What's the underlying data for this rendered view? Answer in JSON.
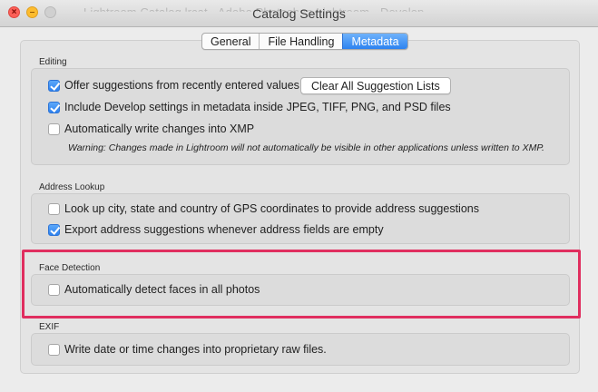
{
  "window": {
    "background_title": "Lightroom Catalog.lrcat - Adobe Photoshop Lightroom - Develop",
    "title": "Catalog Settings"
  },
  "tabs": [
    {
      "label": "General",
      "active": false
    },
    {
      "label": "File Handling",
      "active": false
    },
    {
      "label": "Metadata",
      "active": true
    }
  ],
  "editing": {
    "heading": "Editing",
    "offer_suggestions": {
      "label": "Offer suggestions from recently entered values",
      "checked": true
    },
    "clear_button_label": "Clear All Suggestion Lists",
    "include_develop": {
      "label": "Include Develop settings in metadata inside JPEG, TIFF, PNG, and PSD files",
      "checked": true
    },
    "auto_write_xmp": {
      "label": "Automatically write changes into XMP",
      "checked": false
    },
    "warning": "Warning: Changes made in Lightroom will not automatically be visible in other applications unless written to XMP."
  },
  "address_lookup": {
    "heading": "Address Lookup",
    "lookup_gps": {
      "label": "Look up city, state and country of GPS coordinates to provide address suggestions",
      "checked": false
    },
    "export_suggestions": {
      "label": "Export address suggestions whenever address fields are empty",
      "checked": true
    }
  },
  "face_detection": {
    "heading": "Face Detection",
    "auto_detect": {
      "label": "Automatically detect faces in all photos",
      "checked": false
    }
  },
  "exif": {
    "heading": "EXIF",
    "write_date_time": {
      "label": "Write date or time changes into proprietary raw files.",
      "checked": false
    }
  },
  "colors": {
    "highlight": "#e02e5f",
    "accent": "#2d83f0"
  }
}
